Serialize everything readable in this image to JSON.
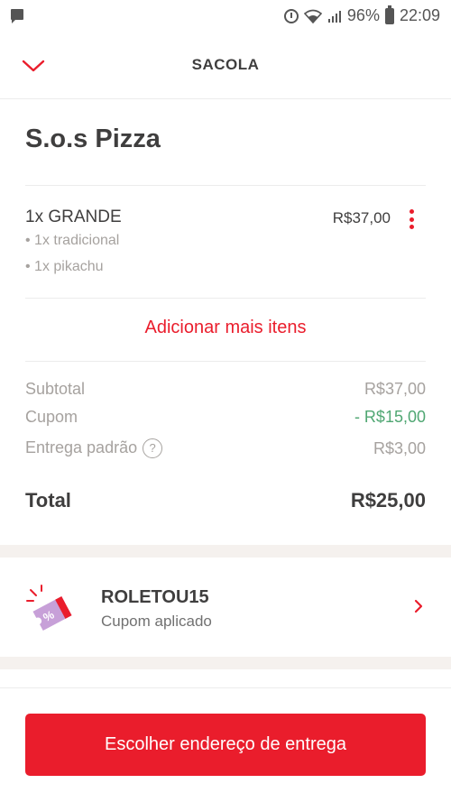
{
  "status_bar": {
    "battery": "96%",
    "time": "22:09",
    "icons": [
      "message-icon",
      "alarm-icon",
      "wifi-icon",
      "signal-icon",
      "battery-icon"
    ]
  },
  "header": {
    "title": "SACOLA",
    "back_icon": "chevron-down-icon"
  },
  "restaurant": {
    "name": "S.o.s Pizza"
  },
  "cart_item": {
    "name": "1x GRANDE",
    "price": "R$37,00",
    "options": [
      "• 1x tradicional",
      "• 1x pikachu"
    ],
    "menu_icon": "more-vertical-icon"
  },
  "add_more": {
    "label": "Adicionar mais itens"
  },
  "summary": {
    "subtotal_label": "Subtotal",
    "subtotal_value": "R$37,00",
    "coupon_label": "Cupom",
    "coupon_value": "- R$15,00",
    "delivery_label": "Entrega padrão",
    "delivery_help": "?",
    "delivery_value": "R$3,00",
    "total_label": "Total",
    "total_value": "R$25,00"
  },
  "coupon": {
    "code": "ROLETOU15",
    "status": "Cupom aplicado",
    "icon": "coupon-ticket-icon",
    "ticket_glyph": "%"
  },
  "cta": {
    "label": "Escolher endereço de entrega"
  },
  "colors": {
    "accent": "#ea1d2c",
    "discount_green": "#50a773",
    "muted_text": "#a6a29f",
    "coupon_purple": "#c7a0d8"
  }
}
